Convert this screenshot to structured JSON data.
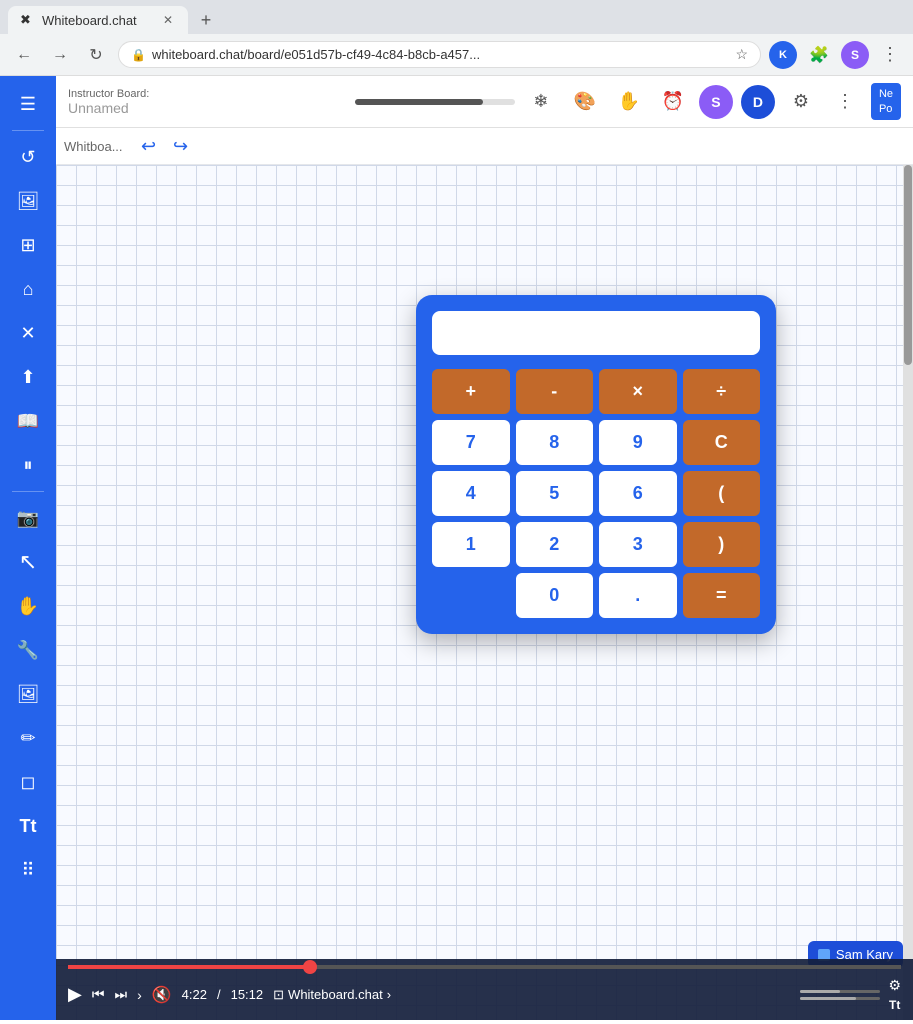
{
  "browser": {
    "tab_title": "Whiteboard.chat",
    "tab_favicon": "✖",
    "url": "whiteboard.chat/board/e051d57b-cf49-4c84-b8cb-a457...",
    "url_lock": "🔒",
    "extensions": {
      "kwik": "K",
      "puzzle": "🧩",
      "avatar": "S"
    }
  },
  "toolbar": {
    "instructor_label": "Instructor Board:",
    "board_name": "Unnamed",
    "board_abbrev": "Whitboa...",
    "avatars": [
      {
        "label": "S",
        "color": "#8b5cf6"
      },
      {
        "label": "D",
        "color": "#1d4ed8"
      }
    ],
    "right_panel_label": "Ne\nPo"
  },
  "undo_redo": {
    "undo_label": "↩",
    "redo_label": "↪"
  },
  "sidebar": {
    "items": [
      {
        "icon": "☰",
        "name": "menu-icon"
      },
      {
        "icon": "↺",
        "name": "refresh-icon"
      },
      {
        "icon": "🖼",
        "name": "image-icon"
      },
      {
        "icon": "⊞",
        "name": "grid-icon"
      },
      {
        "icon": "⌂",
        "name": "home-icon"
      },
      {
        "icon": "✕",
        "name": "close-icon"
      },
      {
        "icon": "⬆",
        "name": "upload-icon"
      },
      {
        "icon": "📖",
        "name": "book-icon"
      },
      {
        "icon": "⏸",
        "name": "pause-icon"
      },
      {
        "icon": "📷",
        "name": "camera-icon"
      },
      {
        "icon": "☁",
        "name": "cloud-icon"
      },
      {
        "icon": "↖",
        "name": "cursor-icon"
      },
      {
        "icon": "✏",
        "name": "pen-icon"
      },
      {
        "icon": "🔧",
        "name": "tool-icon"
      },
      {
        "icon": "🖼",
        "name": "image2-icon"
      },
      {
        "icon": "✒",
        "name": "draw-icon"
      },
      {
        "icon": "◻",
        "name": "eraser-icon"
      },
      {
        "icon": "T",
        "name": "text-icon"
      },
      {
        "icon": "⠿",
        "name": "dots-icon"
      }
    ]
  },
  "calculator": {
    "display_value": "",
    "buttons": [
      {
        "label": "+",
        "type": "op"
      },
      {
        "label": "-",
        "type": "op"
      },
      {
        "label": "×",
        "type": "op"
      },
      {
        "label": "÷",
        "type": "op"
      },
      {
        "label": "7",
        "type": "num"
      },
      {
        "label": "8",
        "type": "num"
      },
      {
        "label": "9",
        "type": "num"
      },
      {
        "label": "C",
        "type": "special"
      },
      {
        "label": "4",
        "type": "num"
      },
      {
        "label": "5",
        "type": "num"
      },
      {
        "label": "6",
        "type": "num"
      },
      {
        "label": "(",
        "type": "special"
      },
      {
        "label": "1",
        "type": "num"
      },
      {
        "label": "2",
        "type": "num"
      },
      {
        "label": "3",
        "type": "num"
      },
      {
        "label": ")",
        "type": "special"
      },
      {
        "label": "",
        "type": "empty"
      },
      {
        "label": "0",
        "type": "num"
      },
      {
        "label": ".",
        "type": "num"
      },
      {
        "label": "=",
        "type": "special"
      }
    ]
  },
  "video": {
    "play_icon": "▶",
    "prev_icon": "⏮",
    "next_icon": "⏭",
    "skip_back_icon": "⏪",
    "mute_icon": "🔇",
    "current_time": "4:22",
    "total_time": "15:12",
    "title": "Whiteboard.chat",
    "arrow_icon": "›",
    "progress_percent": 29
  },
  "name_label": {
    "name": "Sam Kary",
    "color": "#60a5fa"
  },
  "right_panel": {
    "label": "New\nPol"
  }
}
